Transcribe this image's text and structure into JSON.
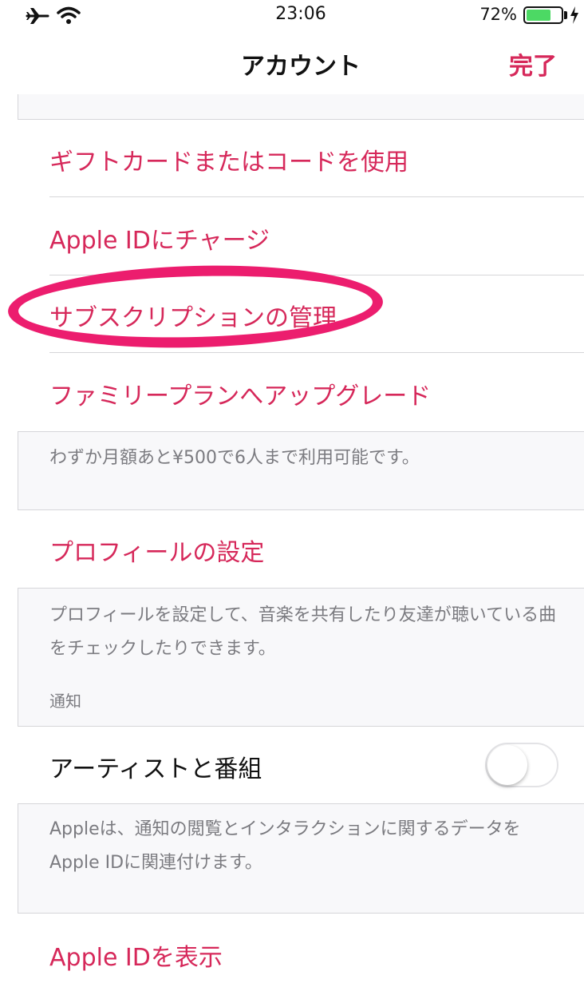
{
  "status_bar": {
    "time": "23:06",
    "battery_percent": "72%",
    "battery_level": 0.72,
    "icons": [
      "airplane-icon",
      "wifi-icon",
      "battery-icon",
      "charging-bolt-icon"
    ]
  },
  "nav": {
    "title": "アカウント",
    "done_label": "完了"
  },
  "items": {
    "gift_card": "ギフトカードまたはコードを使用",
    "add_funds": "Apple IDにチャージ",
    "manage_subscriptions": "サブスクリプションの管理",
    "family_upgrade": "ファミリープランへアップグレード",
    "family_footer": "わずか月額あと¥500で6人まで利用可能です。",
    "profile_setup": "プロフィールの設定",
    "profile_footer": "プロフィールを設定して、音楽を共有したり友達が聴いている曲をチェックしたりできます。",
    "notifications_header": "通知",
    "artists_shows": "アーティストと番組",
    "artists_toggle_on": false,
    "notifications_footer": "Appleは、通知の閲覧とインタラクションに関するデータをApple IDに関連付けます。",
    "view_apple_id": "Apple IDを表示"
  },
  "colors": {
    "accent": "#d6285a",
    "highlight": "#ec1d6e",
    "battery_fill": "#4cd964",
    "background": "#f8f8fa"
  }
}
